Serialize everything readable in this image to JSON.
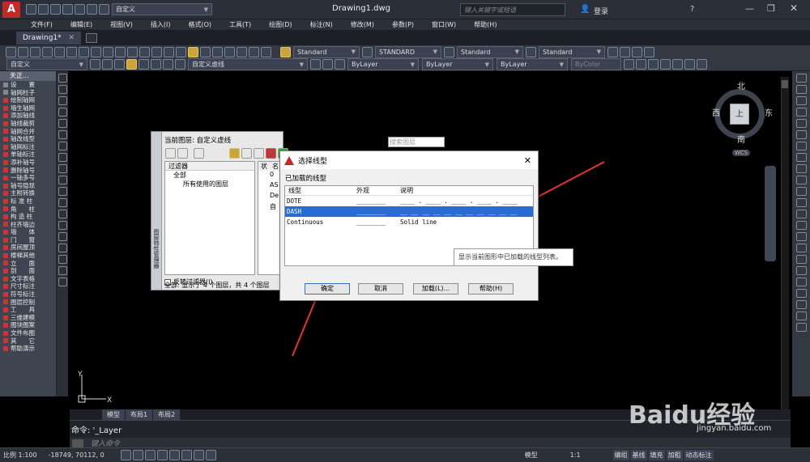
{
  "window": {
    "title": "Drawing1.dwg",
    "search_placeholder": "键入关键字或短语",
    "login": "登录",
    "workspace": "自定义"
  },
  "menu": [
    "文件(F)",
    "编辑(E)",
    "视图(V)",
    "插入(I)",
    "格式(O)",
    "工具(T)",
    "绘图(D)",
    "标注(N)",
    "修改(M)",
    "参数(P)",
    "窗口(W)",
    "帮助(H)"
  ],
  "doc_tab": "Drawing1*",
  "toolbar2": {
    "layer_combo": "自定义",
    "current_layer": "自定义虚线",
    "color": "ByLayer",
    "linetype": "ByLayer",
    "lineweight": "ByLayer",
    "plotstyle": "ByColor",
    "textstyle": "Standard",
    "dimstyle": "STANDARD",
    "tablestyle": "Standard",
    "mleaderstyle": "Standard"
  },
  "left_palette": {
    "header": "天正...",
    "items": [
      "设　　置",
      "轴网柱子",
      "绘制轴网",
      "墙生轴网",
      "添加轴线",
      "轴线裁剪",
      "轴网合并",
      "轴改线型",
      "轴网标注",
      "单轴标注",
      "添补轴号",
      "删除轴号",
      "一轴多号",
      "轴号隐现",
      "主附转换",
      "标 准 柱",
      "角　　柱",
      "构 造 柱",
      "柱齐墙边",
      "墙　　体",
      "门　　窗",
      "房间屋顶",
      "楼梯其他",
      "立　　面",
      "剖　　面",
      "文字表格",
      "尺寸标注",
      "符号标注",
      "图层控制",
      "工　　具",
      "三维建模",
      "图块图案",
      "文件布图",
      "其　　它",
      "帮助演示"
    ]
  },
  "viewcube": {
    "north": "北",
    "south": "南",
    "east": "东",
    "west": "西",
    "top": "上",
    "wcs": "WCS"
  },
  "layer_dialog": {
    "current_layer_label": "当前图层: 自定义虚线",
    "search_placeholder": "搜索图层",
    "filter_header": "过滤器",
    "tree_all": "全部",
    "tree_used": "所有使用的图层",
    "invert_filter": "反转过滤器(I)",
    "status_text": "全部: 显示了 4 个图层，共 4 个图层",
    "columns": [
      "状",
      "名"
    ],
    "layers": [
      "0",
      "AS",
      "De",
      "自"
    ],
    "side_label": "图层特性管理器"
  },
  "linetype_dialog": {
    "title": "选择线型",
    "loaded_label": "已加载的线型",
    "columns": [
      "线型",
      "外观",
      "说明"
    ],
    "rows": [
      {
        "name": "DOTE",
        "appearance": "________",
        "description": "____ . ____ . ____ . ____ . ____"
      },
      {
        "name": "DASH",
        "appearance": "________",
        "description": "__ __ __ __ __ __ __ __ __ __ __"
      },
      {
        "name": "Continuous",
        "appearance": "________",
        "description": "Solid line"
      }
    ],
    "selected_index": 1,
    "buttons": {
      "ok": "确定",
      "cancel": "取消",
      "load": "加载(L)...",
      "help": "帮助(H)"
    }
  },
  "tooltip": "显示当前图形中已加载的线型列表。",
  "layout_tabs": [
    "模型",
    "布局1",
    "布局2"
  ],
  "command": {
    "history": "命令: '_Layer",
    "placeholder": "键入命令"
  },
  "status_bar": {
    "scale": "比例 1:100",
    "coords": "-18749, 70112, 0",
    "model": "模型",
    "annotation_scale": "1:1",
    "buttons": [
      "编组",
      "基线",
      "填充",
      "加粗",
      "动态标注"
    ]
  },
  "watermark": {
    "brand": "Baidu经验",
    "url": "jingyan.baidu.com"
  },
  "colors": {
    "accent_red": "#e8312f",
    "selection_blue": "#2a6dd2",
    "canvas": "#000000"
  }
}
